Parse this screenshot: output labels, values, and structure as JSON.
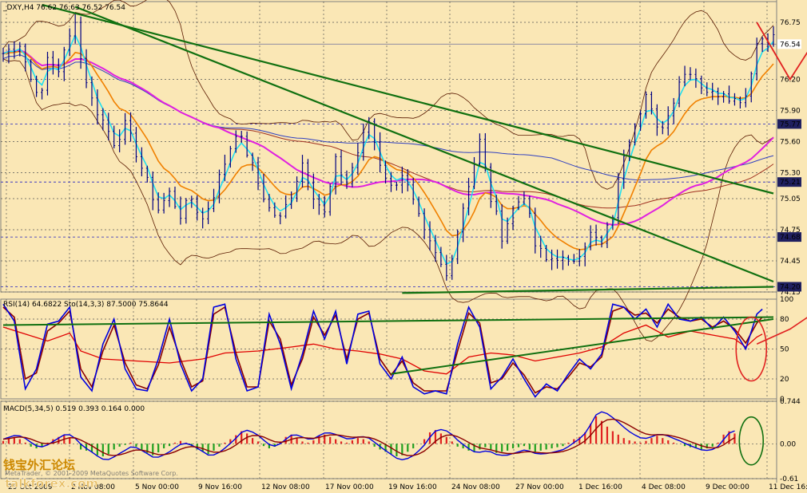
{
  "chart_data": [
    {
      "type": "candlestick",
      "title": "_DXY,H4  76.62 76.63 76.52 76.54",
      "ylim": [
        74.15,
        76.95
      ],
      "y_ticks": [
        "76.75",
        "76.20",
        "75.90",
        "75.60",
        "75.30",
        "75.05",
        "74.75",
        "74.45",
        "74.15"
      ],
      "highlighted_levels": [
        "76.54",
        "75.77",
        "75.21",
        "74.68",
        "74.20"
      ],
      "x_ticks": [
        "29 Oct 2009",
        "2 Nov 08:00",
        "5 Nov 00:00",
        "9 Nov 16:00",
        "12 Nov 08:00",
        "17 Nov 00:00",
        "19 Nov 16:00",
        "24 Nov 08:00",
        "27 Nov 00:00",
        "1 Dec 16:00",
        "4 Dec 08:00",
        "9 Dec 00:00",
        "11 Dec 16:00"
      ],
      "price_path": [
        [
          0,
          76.45
        ],
        [
          3,
          76.55
        ],
        [
          5,
          76.2
        ],
        [
          7,
          76.05
        ],
        [
          8,
          76.4
        ],
        [
          10,
          76.3
        ],
        [
          12,
          76.6
        ],
        [
          13,
          76.8
        ],
        [
          14,
          76.4
        ],
        [
          16,
          76.0
        ],
        [
          18,
          75.8
        ],
        [
          20,
          75.6
        ],
        [
          22,
          75.75
        ],
        [
          24,
          75.5
        ],
        [
          26,
          75.2
        ],
        [
          28,
          74.95
        ],
        [
          30,
          75.1
        ],
        [
          32,
          74.9
        ],
        [
          34,
          75.05
        ],
        [
          36,
          74.85
        ],
        [
          38,
          75.1
        ],
        [
          40,
          75.4
        ],
        [
          42,
          75.7
        ],
        [
          44,
          75.5
        ],
        [
          46,
          75.2
        ],
        [
          48,
          74.95
        ],
        [
          50,
          74.85
        ],
        [
          52,
          75.1
        ],
        [
          54,
          75.4
        ],
        [
          56,
          75.1
        ],
        [
          58,
          74.9
        ],
        [
          60,
          75.4
        ],
        [
          62,
          75.2
        ],
        [
          64,
          75.5
        ],
        [
          66,
          75.8
        ],
        [
          68,
          75.4
        ],
        [
          70,
          75.15
        ],
        [
          72,
          75.3
        ],
        [
          74,
          75.0
        ],
        [
          76,
          74.7
        ],
        [
          78,
          74.5
        ],
        [
          80,
          74.3
        ],
        [
          82,
          74.75
        ],
        [
          84,
          75.2
        ],
        [
          86,
          75.6
        ],
        [
          88,
          75.05
        ],
        [
          90,
          74.7
        ],
        [
          92,
          74.95
        ],
        [
          94,
          75.1
        ],
        [
          96,
          74.6
        ],
        [
          98,
          74.45
        ],
        [
          100,
          74.5
        ],
        [
          102,
          74.4
        ],
        [
          104,
          74.55
        ],
        [
          106,
          74.7
        ],
        [
          108,
          74.6
        ],
        [
          110,
          74.9
        ],
        [
          112,
          75.5
        ],
        [
          114,
          75.8
        ],
        [
          116,
          76.05
        ],
        [
          118,
          75.7
        ],
        [
          120,
          75.85
        ],
        [
          122,
          76.2
        ],
        [
          124,
          76.3
        ],
        [
          126,
          76.15
        ],
        [
          128,
          76.05
        ],
        [
          130,
          76.1
        ],
        [
          132,
          76.0
        ],
        [
          134,
          76.05
        ],
        [
          136,
          76.55
        ],
        [
          137,
          76.6
        ]
      ],
      "bars": 140,
      "forecast_arrow": [
        [
          136,
          76.75
        ],
        [
          142,
          76.2
        ],
        [
          151,
          76.95
        ]
      ],
      "overlays": [
        "cyan fast MA",
        "orange MA",
        "brown MA",
        "magenta MA",
        "blue MA",
        "Bollinger bands",
        "green trendlines"
      ]
    },
    {
      "type": "line",
      "title": "RSI(14) 64.6822  Sto(14,3,3) 87.5000 75.8644",
      "ylim": [
        0,
        100
      ],
      "y_ticks": [
        "100",
        "80",
        "50",
        "20",
        "0"
      ],
      "series": [
        {
          "name": "RSI(14)",
          "color": "#e00000",
          "values": [
            [
              0,
              72
            ],
            [
              4,
              65
            ],
            [
              8,
              58
            ],
            [
              12,
              66
            ],
            [
              14,
              48
            ],
            [
              18,
              40
            ],
            [
              24,
              38
            ],
            [
              30,
              36
            ],
            [
              36,
              40
            ],
            [
              40,
              46
            ],
            [
              46,
              48
            ],
            [
              52,
              52
            ],
            [
              56,
              55
            ],
            [
              60,
              50
            ],
            [
              64,
              48
            ],
            [
              68,
              45
            ],
            [
              72,
              40
            ],
            [
              76,
              28
            ],
            [
              80,
              25
            ],
            [
              84,
              42
            ],
            [
              88,
              46
            ],
            [
              92,
              44
            ],
            [
              96,
              38
            ],
            [
              100,
              42
            ],
            [
              104,
              46
            ],
            [
              108,
              52
            ],
            [
              112,
              66
            ],
            [
              116,
              74
            ],
            [
              120,
              62
            ],
            [
              124,
              68
            ],
            [
              128,
              64
            ],
            [
              132,
              60
            ],
            [
              134,
              52
            ],
            [
              136,
              62
            ],
            [
              137,
              65
            ]
          ]
        },
        {
          "name": "Sto(14,3,3)",
          "color": "#0000e0",
          "values": [
            [
              0,
              95
            ],
            [
              2,
              78
            ],
            [
              4,
              10
            ],
            [
              6,
              30
            ],
            [
              8,
              75
            ],
            [
              10,
              78
            ],
            [
              12,
              92
            ],
            [
              14,
              22
            ],
            [
              16,
              8
            ],
            [
              18,
              55
            ],
            [
              20,
              80
            ],
            [
              22,
              30
            ],
            [
              24,
              10
            ],
            [
              26,
              8
            ],
            [
              28,
              40
            ],
            [
              30,
              80
            ],
            [
              32,
              35
            ],
            [
              34,
              8
            ],
            [
              36,
              20
            ],
            [
              38,
              92
            ],
            [
              40,
              95
            ],
            [
              42,
              40
            ],
            [
              44,
              8
            ],
            [
              46,
              12
            ],
            [
              48,
              85
            ],
            [
              50,
              55
            ],
            [
              52,
              10
            ],
            [
              54,
              45
            ],
            [
              56,
              88
            ],
            [
              58,
              60
            ],
            [
              60,
              88
            ],
            [
              62,
              35
            ],
            [
              64,
              85
            ],
            [
              66,
              88
            ],
            [
              68,
              35
            ],
            [
              70,
              20
            ],
            [
              72,
              42
            ],
            [
              74,
              12
            ],
            [
              76,
              5
            ],
            [
              78,
              8
            ],
            [
              80,
              5
            ],
            [
              82,
              55
            ],
            [
              84,
              92
            ],
            [
              86,
              72
            ],
            [
              88,
              10
            ],
            [
              90,
              22
            ],
            [
              92,
              40
            ],
            [
              94,
              20
            ],
            [
              96,
              2
            ],
            [
              98,
              15
            ],
            [
              100,
              8
            ],
            [
              102,
              25
            ],
            [
              104,
              40
            ],
            [
              106,
              30
            ],
            [
              108,
              45
            ],
            [
              110,
              95
            ],
            [
              112,
              92
            ],
            [
              114,
              80
            ],
            [
              116,
              90
            ],
            [
              118,
              72
            ],
            [
              120,
              95
            ],
            [
              122,
              80
            ],
            [
              124,
              78
            ],
            [
              126,
              82
            ],
            [
              128,
              70
            ],
            [
              130,
              82
            ],
            [
              132,
              68
            ],
            [
              134,
              50
            ],
            [
              136,
              85
            ],
            [
              137,
              90
            ]
          ]
        },
        {
          "name": "signal",
          "color": "#8b0000",
          "values": [
            [
              0,
              92
            ],
            [
              2,
              82
            ],
            [
              4,
              20
            ],
            [
              6,
              26
            ],
            [
              8,
              68
            ],
            [
              10,
              76
            ],
            [
              12,
              88
            ],
            [
              14,
              30
            ],
            [
              16,
              12
            ],
            [
              18,
              48
            ],
            [
              20,
              74
            ],
            [
              22,
              36
            ],
            [
              24,
              14
            ],
            [
              26,
              10
            ],
            [
              28,
              34
            ],
            [
              30,
              72
            ],
            [
              32,
              40
            ],
            [
              34,
              12
            ],
            [
              36,
              18
            ],
            [
              38,
              85
            ],
            [
              40,
              92
            ],
            [
              42,
              46
            ],
            [
              44,
              12
            ],
            [
              46,
              12
            ],
            [
              48,
              78
            ],
            [
              50,
              60
            ],
            [
              52,
              14
            ],
            [
              54,
              40
            ],
            [
              56,
              82
            ],
            [
              58,
              64
            ],
            [
              60,
              84
            ],
            [
              62,
              40
            ],
            [
              64,
              80
            ],
            [
              66,
              86
            ],
            [
              68,
              40
            ],
            [
              70,
              24
            ],
            [
              72,
              38
            ],
            [
              74,
              16
            ],
            [
              76,
              8
            ],
            [
              78,
              8
            ],
            [
              80,
              8
            ],
            [
              82,
              48
            ],
            [
              84,
              86
            ],
            [
              86,
              76
            ],
            [
              88,
              16
            ],
            [
              90,
              20
            ],
            [
              92,
              36
            ],
            [
              94,
              24
            ],
            [
              96,
              6
            ],
            [
              98,
              12
            ],
            [
              100,
              10
            ],
            [
              102,
              22
            ],
            [
              104,
              36
            ],
            [
              106,
              32
            ],
            [
              108,
              42
            ],
            [
              110,
              88
            ],
            [
              112,
              92
            ],
            [
              114,
              84
            ],
            [
              116,
              86
            ],
            [
              118,
              76
            ],
            [
              120,
              90
            ],
            [
              122,
              82
            ],
            [
              124,
              78
            ],
            [
              126,
              80
            ],
            [
              128,
              72
            ],
            [
              130,
              78
            ],
            [
              132,
              70
            ],
            [
              134,
              56
            ],
            [
              136,
              76
            ],
            [
              137,
              82
            ]
          ]
        }
      ],
      "forecast_arrow": [
        [
          136,
          55
        ],
        [
          142,
          70
        ],
        [
          150,
          100
        ]
      ]
    },
    {
      "type": "bar",
      "title": "MACD(5,34,5) 0.519 0.393 0.164 0.000",
      "ylim": [
        -0.61,
        0.744
      ],
      "y_ticks": [
        "0.744",
        "0.00",
        "-0.61"
      ],
      "histogram": [
        0.05,
        0.1,
        0.12,
        0.08,
        0.02,
        -0.05,
        -0.08,
        -0.05,
        0.02,
        0.08,
        0.12,
        0.15,
        0.1,
        0.0,
        -0.1,
        -0.12,
        -0.15,
        -0.2,
        -0.22,
        -0.18,
        -0.1,
        -0.05,
        -0.02,
        0.02,
        -0.05,
        -0.12,
        -0.16,
        -0.2,
        -0.15,
        -0.08,
        -0.04,
        0.02,
        0.05,
        0.02,
        -0.04,
        -0.1,
        -0.14,
        -0.18,
        -0.12,
        -0.05,
        0.02,
        0.08,
        0.15,
        0.22,
        0.18,
        0.1,
        0.04,
        -0.04,
        -0.08,
        -0.05,
        0.04,
        0.12,
        0.16,
        0.1,
        0.04,
        0.02,
        0.06,
        0.14,
        0.16,
        0.12,
        0.08,
        0.04,
        0.02,
        0.06,
        0.1,
        0.08,
        0.04,
        -0.05,
        -0.1,
        -0.14,
        -0.18,
        -0.22,
        -0.2,
        -0.14,
        -0.08,
        0.0,
        0.08,
        0.2,
        0.24,
        0.18,
        0.12,
        0.04,
        -0.05,
        -0.08,
        -0.12,
        -0.14,
        -0.1,
        -0.06,
        -0.1,
        -0.16,
        -0.14,
        -0.12,
        -0.08,
        -0.06,
        -0.04,
        -0.1,
        -0.14,
        -0.12,
        -0.1,
        -0.08,
        -0.06,
        -0.04,
        0.02,
        0.08,
        0.12,
        0.2,
        0.35,
        0.48,
        0.4,
        0.3,
        0.22,
        0.16,
        0.1,
        0.06,
        0.04,
        0.02,
        0.05,
        0.1,
        0.14,
        0.1,
        0.06,
        0.02,
        0.0,
        -0.04,
        -0.06,
        -0.08,
        -0.1,
        -0.08,
        -0.05,
        0.02,
        0.16,
        0.22,
        0.18
      ]
    }
  ],
  "watermark": {
    "logo_cn": "钱宝外汇论坛",
    "site": "talkforex.com",
    "copyright": "MetaTrader, © 2001-2009 MetaQuotes Software Corp."
  }
}
